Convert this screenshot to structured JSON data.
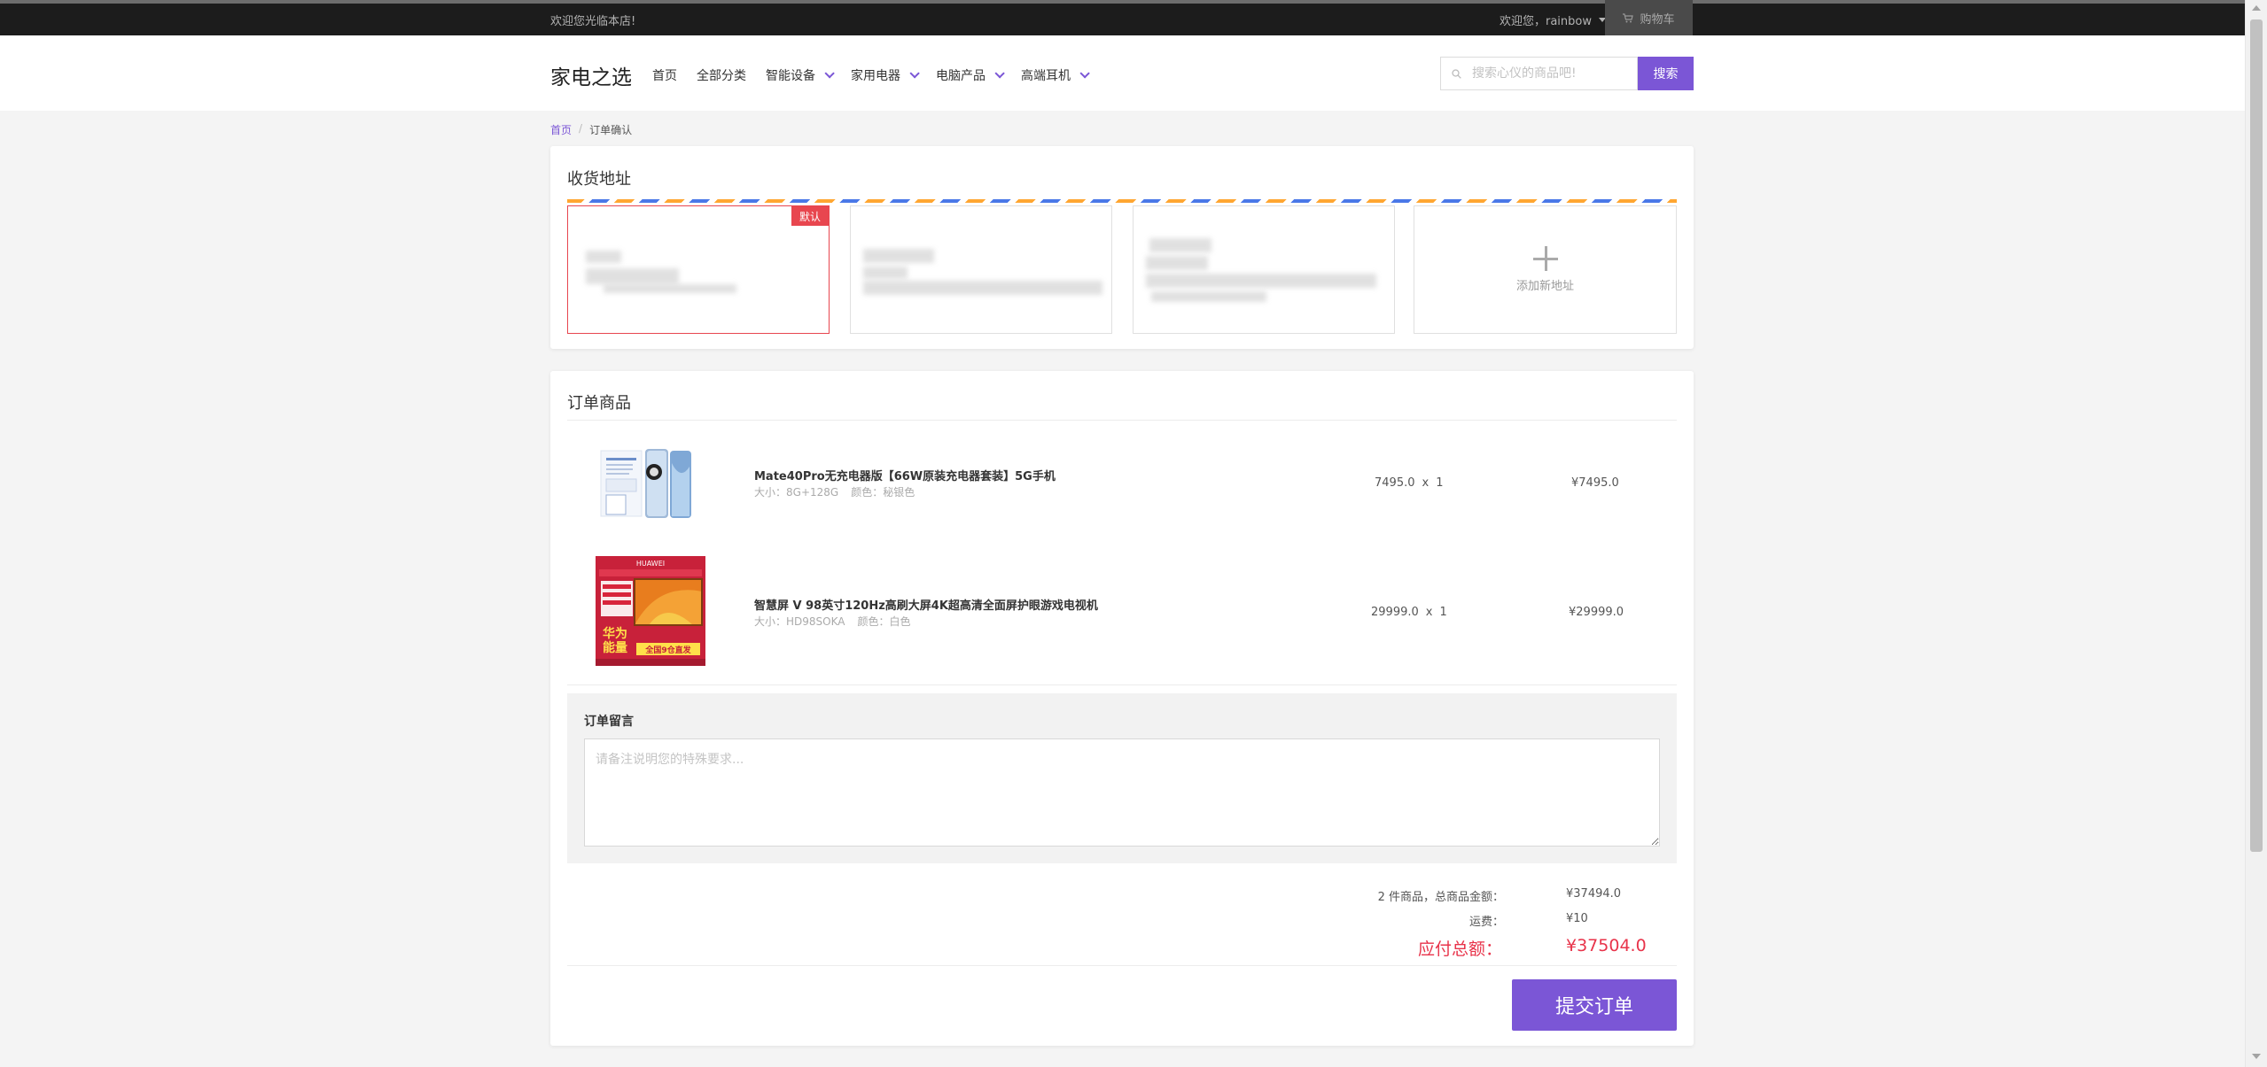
{
  "topbar": {
    "welcome": "欢迎您光临本店!",
    "user_greeting": "欢迎您，rainbow",
    "cart_label": "购物车"
  },
  "header": {
    "logo": "家电之选",
    "nav": [
      {
        "label": "首页"
      },
      {
        "label": "全部分类"
      },
      {
        "label": "智能设备"
      },
      {
        "label": "家用电器"
      },
      {
        "label": "电脑产品"
      },
      {
        "label": "高端耳机"
      }
    ],
    "search_placeholder": "搜索心仪的商品吧!",
    "search_button": "搜索"
  },
  "breadcrumb": {
    "home": "首页",
    "separator": "/",
    "current": "订单确认"
  },
  "address": {
    "title": "收货地址",
    "default_tag": "默认",
    "add_label": "添加新地址"
  },
  "order": {
    "title": "订单商品",
    "items": [
      {
        "name": "Mate40Pro无充电器版【66W原装充电器套装】5G手机",
        "size_label": "大小：",
        "size": "8G+128G",
        "color_label": "颜色：",
        "color": "秘银色",
        "price": "7495.0",
        "times": "x",
        "qty": "1",
        "subtotal": "¥7495.0"
      },
      {
        "name": "智慧屏 V 98英寸120Hz高刷大屏4K超高清全面屏护眼游戏电视机",
        "size_label": "大小：",
        "size": "HD98SOKA",
        "color_label": "颜色：",
        "color": "白色",
        "price": "29999.0",
        "times": "x",
        "qty": "1",
        "subtotal": "¥29999.0"
      }
    ],
    "tv_image_texts": {
      "brand": "HUAWEI",
      "slogan_1": "华为",
      "slogan_2": "能量",
      "banner": "全国9仓直发"
    }
  },
  "message": {
    "label": "订单留言",
    "placeholder": "请备注说明您的特殊要求..."
  },
  "summary": {
    "goods_label": "2 件商品，总商品金额：",
    "goods_value": "¥37494.0",
    "shipping_label": "运费：",
    "shipping_value": "¥10",
    "total_label": "应付总额：",
    "total_value": "¥37504.0"
  },
  "submit_label": "提交订单",
  "colors": {
    "accent": "#7b56d6",
    "danger": "#e8334a",
    "topbar": "#1c1c1c"
  }
}
